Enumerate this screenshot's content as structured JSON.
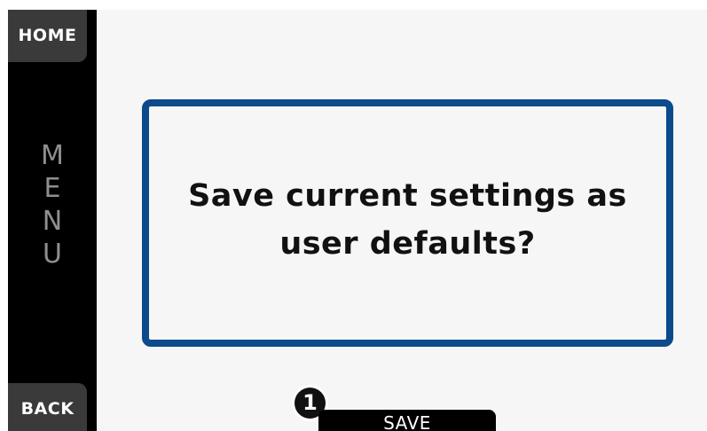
{
  "sidebar": {
    "home_label": "HOME",
    "menu_letters": [
      "M",
      "E",
      "N",
      "U"
    ],
    "back_label": "BACK"
  },
  "dialog": {
    "line1": "Save current settings as",
    "line2": "user defaults?"
  },
  "callout": {
    "number": "1"
  },
  "actions": {
    "save_label": "SAVE"
  },
  "colors": {
    "dialog_border": "#0b4a8b",
    "screen_background": "#f6f6f6",
    "sidebar_background": "#000000",
    "sidebar_button": "#3a3a3a"
  }
}
